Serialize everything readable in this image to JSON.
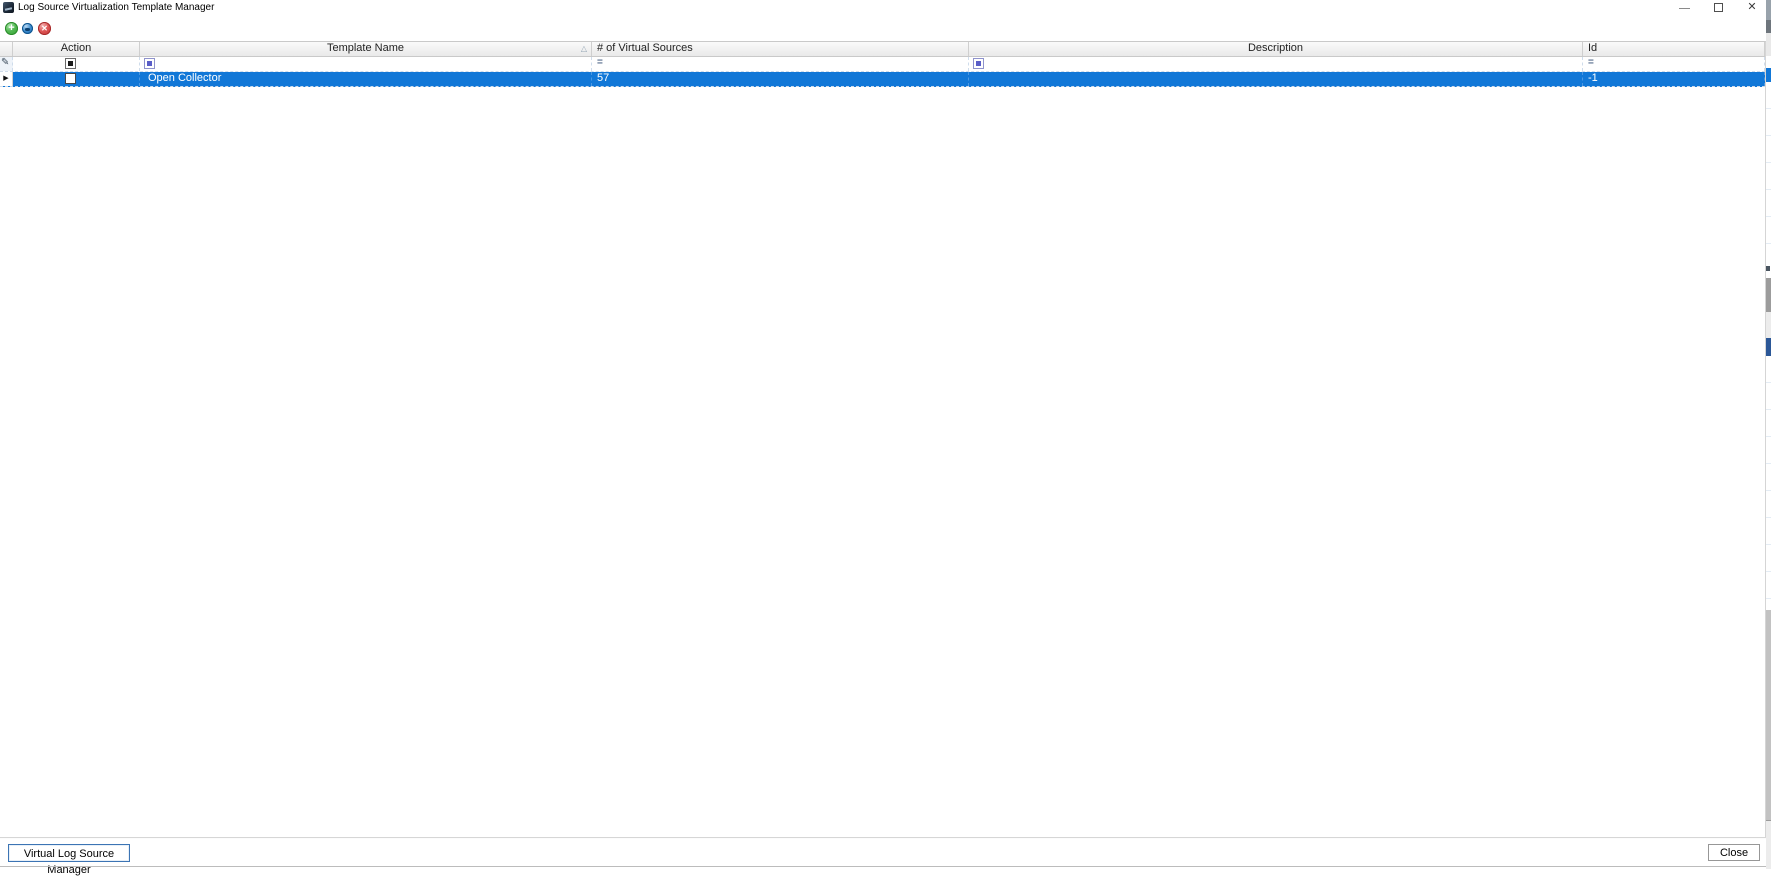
{
  "window": {
    "title": "Log Source Virtualization Template Manager"
  },
  "icons": {
    "add_glyph": "+",
    "delete_glyph": "✕",
    "sort_ascending": "△",
    "filter_pencil": "✎",
    "row_arrow": "▶"
  },
  "grid": {
    "columns": [
      {
        "id": "action",
        "label": "Action"
      },
      {
        "id": "template_name",
        "label": "Template Name",
        "sorted": "ascending"
      },
      {
        "id": "virtual_sources",
        "label": "# of Virtual Sources"
      },
      {
        "id": "description",
        "label": "Description"
      },
      {
        "id": "id",
        "label": "Id"
      }
    ],
    "filter_row": {
      "action_checkbox_state": "indeterminate",
      "template_name_checkbox_state": "indeterminate",
      "description_checkbox_state": "indeterminate",
      "virtual_sources_operator": "=",
      "id_operator": "="
    },
    "rows": [
      {
        "selected": true,
        "action_checked": false,
        "template_name": "Open Collector",
        "virtual_sources": "57",
        "description": "",
        "id": "-1"
      }
    ]
  },
  "footer": {
    "left_button_label": "Virtual Log Source Manager",
    "close_button_label": "Close"
  },
  "colors": {
    "selection_blue": "#1177d7",
    "toolbar_add_green": "#2e9e2e",
    "toolbar_edit_blue": "#135fa8",
    "toolbar_delete_red": "#c03030"
  }
}
